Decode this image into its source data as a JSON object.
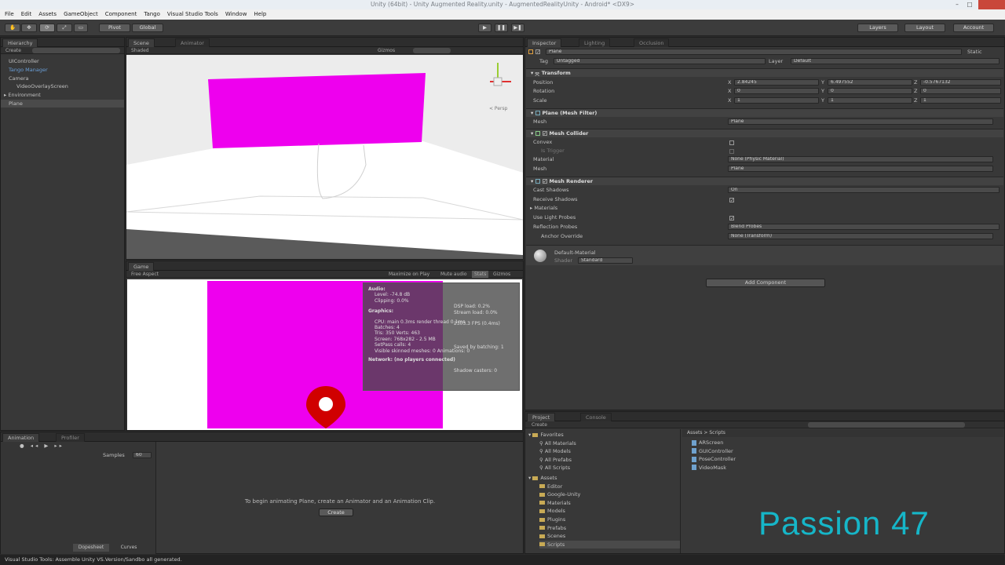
{
  "window": {
    "title": "Unity (64bit) - Unity Augmented Reality.unity - AugmentedRealityUnity - Android* <DX9>"
  },
  "menu": [
    "File",
    "Edit",
    "Assets",
    "GameObject",
    "Component",
    "Tango",
    "Visual Studio Tools",
    "Window",
    "Help"
  ],
  "toolbar": {
    "pivot": "Pivot",
    "global": "Global",
    "layers": "Layers",
    "layout": "Layout",
    "account": "Account"
  },
  "hierarchy": {
    "tab": "Hierarchy",
    "create": "Create",
    "items": [
      "UIController",
      "Tango Manager",
      "Camera",
      "VideoOverlayScreen",
      "Environment",
      "Plane"
    ]
  },
  "scene": {
    "tab": "Scene",
    "tab2": "Animator",
    "shaded": "Shaded",
    "gizmos": "Gizmos",
    "persp": "< Persp"
  },
  "game": {
    "tab": "Game",
    "aspect": "Free Aspect",
    "maximize": "Maximize on Play",
    "mute": "Mute audio",
    "stats": "Stats",
    "gizmos": "Gizmos"
  },
  "stats": {
    "audio": "Audio:",
    "level": "Level: -74.8 dB",
    "clipping": "Clipping: 0.0%",
    "dsp": "DSP load: 0.2%",
    "stream": "Stream load: 0.0%",
    "graphics": "Graphics:",
    "fps": "2303.3 FPS (0.4ms)",
    "cpu": "CPU: main 0.3ms  render thread 0.1ms",
    "batches": "Batches: 4",
    "saved": "Saved by batching: 1",
    "tris": "Tris: 350  Verts: 463",
    "screen": "Screen: 768x282 - 2.5 MB",
    "setpass": "SetPass calls: 4",
    "shadow": "Shadow casters: 0",
    "visible": "Visible skinned meshes: 0  Animations: 0",
    "network": "Network: (no players connected)"
  },
  "inspector": {
    "tab": "Inspector",
    "tab2": "Lighting",
    "tab3": "Occlusion",
    "name": "Plane",
    "static": "Static",
    "tag_label": "Tag",
    "tag": "Untagged",
    "layer_label": "Layer",
    "layer": "Default",
    "transform": "Transform",
    "position": "Position",
    "rotation": "Rotation",
    "scale": "Scale",
    "px": "2.84245",
    "py": "6.497552",
    "pz": "-0.5767132",
    "rx": "0",
    "ry": "0",
    "rz": "0",
    "sx": "1",
    "sy": "1",
    "sz": "1",
    "meshfilter": "Plane (Mesh Filter)",
    "mesh": "Mesh",
    "mesh_val": "Plane",
    "collider": "Mesh Collider",
    "convex": "Convex",
    "trigger": "Is Trigger",
    "material": "Material",
    "material_val": "None (Physic Material)",
    "mesh2_val": "Plane",
    "renderer": "Mesh Renderer",
    "cast": "Cast Shadows",
    "cast_val": "On",
    "receive": "Receive Shadows",
    "materials": "Materials",
    "probes": "Use Light Probes",
    "reflection": "Reflection Probes",
    "reflection_val": "Blend Probes",
    "anchor": "Anchor Override",
    "anchor_val": "None (Transform)",
    "defmat": "Default-Material",
    "shader": "Shader",
    "shader_val": "Standard",
    "add": "Add Component"
  },
  "animation": {
    "tab": "Animation",
    "tab2": "Profiler",
    "samples": "Samples",
    "samples_val": "60",
    "message": "To begin animating Plane, create an Animator and an Animation Clip.",
    "create": "Create",
    "dopesheet": "Dopesheet",
    "curves": "Curves"
  },
  "project": {
    "tab": "Project",
    "tab2": "Console",
    "create": "Create",
    "favorites": "Favorites",
    "fav_items": [
      "All Materials",
      "All Models",
      "All Prefabs",
      "All Scripts"
    ],
    "assets": "Assets",
    "folders": [
      "Editor",
      "Google-Unity",
      "Materials",
      "Models",
      "Plugins",
      "Prefabs",
      "Scenes",
      "Scripts"
    ],
    "path": "Assets > Scripts",
    "scripts": [
      "ARScreen",
      "GUIController",
      "PoseController",
      "VideoMask"
    ]
  },
  "status": {
    "text": "Visual Studio Tools: Assemble Unity VS.Version/Sandbo all generated."
  },
  "watermark": "Passion 47"
}
